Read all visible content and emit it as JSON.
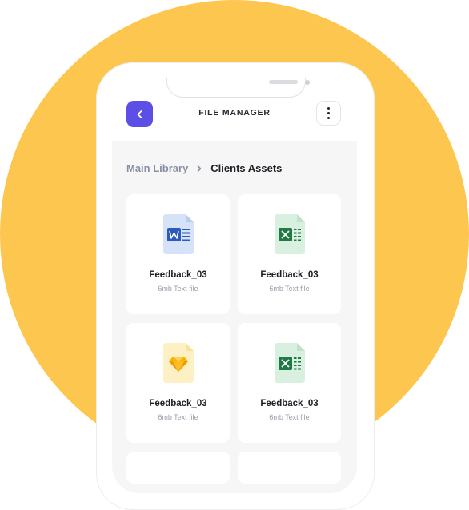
{
  "header": {
    "title": "FILE MANAGER",
    "back_icon": "chevron-left-icon",
    "more_icon": "more-vertical-icon"
  },
  "breadcrumb": {
    "parent": "Main Library",
    "current": "Clients Assets",
    "separator_icon": "chevron-right-icon"
  },
  "files": [
    {
      "name": "Feedback_03",
      "meta": "6mb Text file",
      "type": "word"
    },
    {
      "name": "Feedback_03",
      "meta": "6mb Text file",
      "type": "excel"
    },
    {
      "name": "Feedback_03",
      "meta": "6mb Text file",
      "type": "sketch"
    },
    {
      "name": "Feedback_03",
      "meta": "6mb Text file",
      "type": "excel"
    }
  ],
  "colors": {
    "background_circle": "#FCC64F",
    "accent": "#5B4FE5",
    "word": "#2B5BBE",
    "excel": "#1F7A43",
    "sketch": "#F7B500"
  }
}
